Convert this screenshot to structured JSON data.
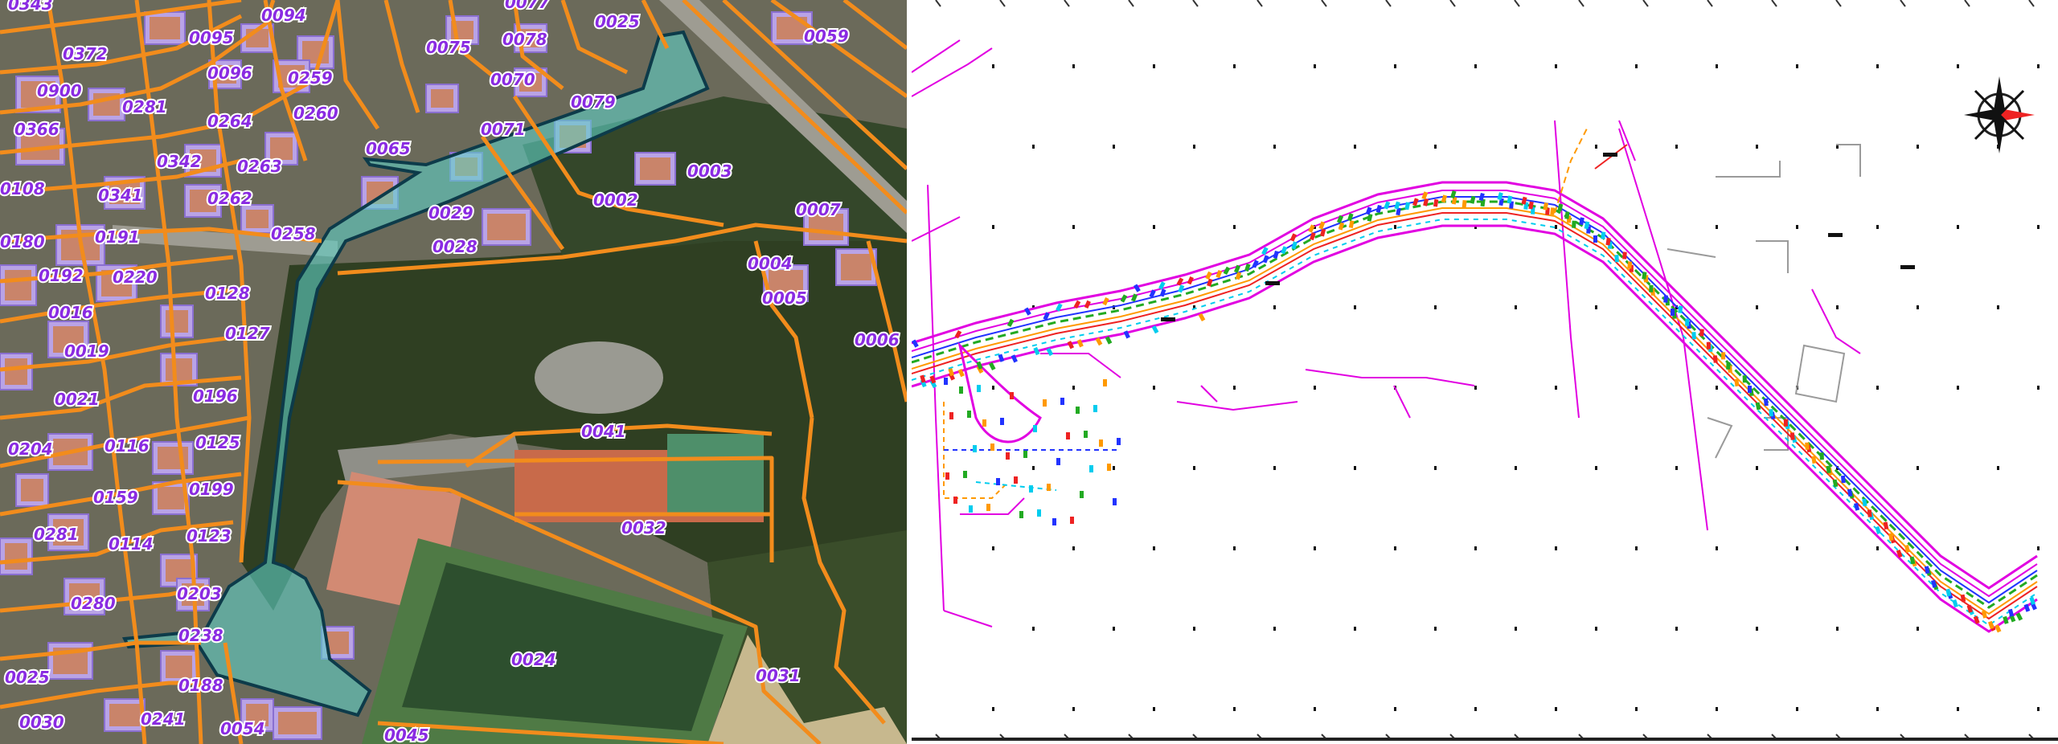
{
  "left_map": {
    "parcels": [
      {
        "id": "p1",
        "label": "0343"
      },
      {
        "id": "p2",
        "label": "0094"
      },
      {
        "id": "p3",
        "label": "0077"
      },
      {
        "id": "p4",
        "label": "0025"
      },
      {
        "id": "p5",
        "label": "0059"
      },
      {
        "id": "p6",
        "label": "0372"
      },
      {
        "id": "p7",
        "label": "0095"
      },
      {
        "id": "p8",
        "label": "0075"
      },
      {
        "id": "p9",
        "label": "0078"
      },
      {
        "id": "p10",
        "label": "0096"
      },
      {
        "id": "p11",
        "label": "0259"
      },
      {
        "id": "p12",
        "label": "0070"
      },
      {
        "id": "p13",
        "label": "0900"
      },
      {
        "id": "p14",
        "label": "0281"
      },
      {
        "id": "p15",
        "label": "0079"
      },
      {
        "id": "p16",
        "label": "0366"
      },
      {
        "id": "p17",
        "label": "0264"
      },
      {
        "id": "p18",
        "label": "0260"
      },
      {
        "id": "p19",
        "label": "0071"
      },
      {
        "id": "p20",
        "label": "0065"
      },
      {
        "id": "p21",
        "label": "0342"
      },
      {
        "id": "p22",
        "label": "0263"
      },
      {
        "id": "p23",
        "label": "0003"
      },
      {
        "id": "p24",
        "label": "0108"
      },
      {
        "id": "p25",
        "label": "0341"
      },
      {
        "id": "p26",
        "label": "0262"
      },
      {
        "id": "p27",
        "label": "0029"
      },
      {
        "id": "p28",
        "label": "0002"
      },
      {
        "id": "p29",
        "label": "0007"
      },
      {
        "id": "p30",
        "label": "0180"
      },
      {
        "id": "p31",
        "label": "0191"
      },
      {
        "id": "p32",
        "label": "0258"
      },
      {
        "id": "p33",
        "label": "0028"
      },
      {
        "id": "p34",
        "label": "0192"
      },
      {
        "id": "p35",
        "label": "0220"
      },
      {
        "id": "p36",
        "label": "0004"
      },
      {
        "id": "p37",
        "label": "0128"
      },
      {
        "id": "p38",
        "label": "0005"
      },
      {
        "id": "p39",
        "label": "0016"
      },
      {
        "id": "p40",
        "label": "0127"
      },
      {
        "id": "p41",
        "label": "0006"
      },
      {
        "id": "p42",
        "label": "0019"
      },
      {
        "id": "p43",
        "label": "0021"
      },
      {
        "id": "p44",
        "label": "0196"
      },
      {
        "id": "p45",
        "label": "0041"
      },
      {
        "id": "p46",
        "label": "0204"
      },
      {
        "id": "p47",
        "label": "0116"
      },
      {
        "id": "p48",
        "label": "0125"
      },
      {
        "id": "p49",
        "label": "0159"
      },
      {
        "id": "p50",
        "label": "0199"
      },
      {
        "id": "p51",
        "label": "0281"
      },
      {
        "id": "p52",
        "label": "0114"
      },
      {
        "id": "p53",
        "label": "0123"
      },
      {
        "id": "p54",
        "label": "0032"
      },
      {
        "id": "p55",
        "label": "0203"
      },
      {
        "id": "p56",
        "label": "0280"
      },
      {
        "id": "p57",
        "label": "0238"
      },
      {
        "id": "p58",
        "label": "0024"
      },
      {
        "id": "p59",
        "label": "0025"
      },
      {
        "id": "p60",
        "label": "0188"
      },
      {
        "id": "p61",
        "label": "0031"
      },
      {
        "id": "p62",
        "label": "0030"
      },
      {
        "id": "p63",
        "label": "0241"
      },
      {
        "id": "p64",
        "label": "0054"
      },
      {
        "id": "p65",
        "label": "0045"
      }
    ],
    "colors": {
      "parcel_line": "#f28c1c",
      "label": "#8a2be2",
      "highlight_fill": "#5fd1c6",
      "highlight_stroke": "#0d3b4a",
      "building": "#b9a3e6",
      "vegetation": "#2f3f22",
      "track": "#4f7a45",
      "roof_orange": "#d9774a"
    }
  },
  "right_plan": {
    "compass_icon": "compass-rose-icon",
    "colors": {
      "magenta": "#e100e1",
      "blue": "#2233ff",
      "green": "#22aa22",
      "orange": "#ff9900",
      "cyan": "#00ccee",
      "red": "#ee2222",
      "grey": "#999999",
      "dot": "#111111"
    }
  }
}
